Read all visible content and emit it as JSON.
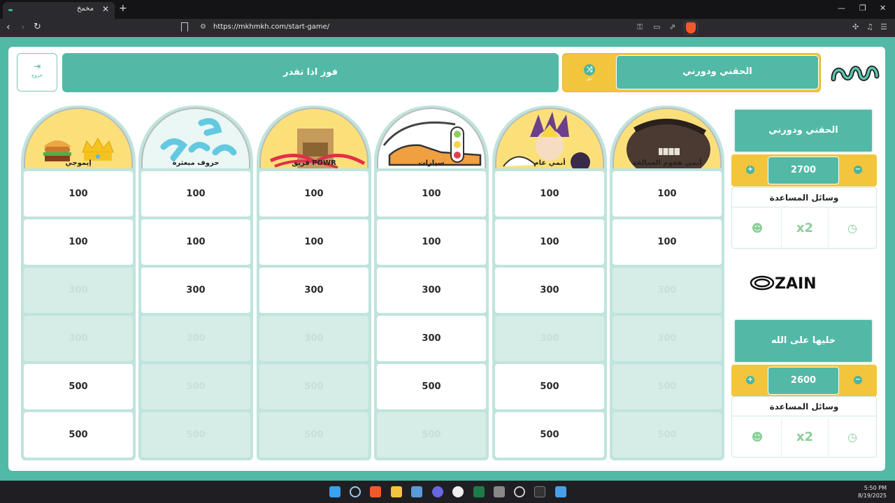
{
  "browser": {
    "tab_title": "مخمخ",
    "tab_close": "✕",
    "new_tab": "+",
    "url": "https://mkhmkh.com/start-game/",
    "win_min": "—",
    "win_max": "❐",
    "win_close": "✕"
  },
  "header": {
    "exit_label": "خروج",
    "game_title": "فوز اذا تقدر",
    "turn_team": "الحقني ودورني",
    "turn_sub": "دور"
  },
  "categories": [
    {
      "title": "إيموجي",
      "cells": [
        {
          "v": "100",
          "on": true
        },
        {
          "v": "100",
          "on": true
        },
        {
          "v": "300",
          "on": false
        },
        {
          "v": "300",
          "on": false
        },
        {
          "v": "500",
          "on": true
        },
        {
          "v": "500",
          "on": true
        }
      ]
    },
    {
      "title": "حروف مبعثرة",
      "cells": [
        {
          "v": "100",
          "on": true
        },
        {
          "v": "100",
          "on": true
        },
        {
          "v": "300",
          "on": true
        },
        {
          "v": "300",
          "on": false
        },
        {
          "v": "500",
          "on": false
        },
        {
          "v": "500",
          "on": false
        }
      ]
    },
    {
      "title": "فريق POWR",
      "cells": [
        {
          "v": "100",
          "on": true
        },
        {
          "v": "100",
          "on": true
        },
        {
          "v": "300",
          "on": true
        },
        {
          "v": "300",
          "on": false
        },
        {
          "v": "500",
          "on": false
        },
        {
          "v": "500",
          "on": false
        }
      ]
    },
    {
      "title": "سيارات",
      "cells": [
        {
          "v": "100",
          "on": true
        },
        {
          "v": "100",
          "on": true
        },
        {
          "v": "300",
          "on": true
        },
        {
          "v": "300",
          "on": true
        },
        {
          "v": "500",
          "on": true
        },
        {
          "v": "500",
          "on": false
        }
      ]
    },
    {
      "title": "أنمي عام",
      "cells": [
        {
          "v": "100",
          "on": true
        },
        {
          "v": "100",
          "on": true
        },
        {
          "v": "300",
          "on": true
        },
        {
          "v": "300",
          "on": false
        },
        {
          "v": "500",
          "on": true
        },
        {
          "v": "500",
          "on": true
        }
      ]
    },
    {
      "title": "أنمي هجوم العمالقة",
      "cells": [
        {
          "v": "100",
          "on": true
        },
        {
          "v": "100",
          "on": true
        },
        {
          "v": "300",
          "on": false
        },
        {
          "v": "300",
          "on": false
        },
        {
          "v": "500",
          "on": false
        },
        {
          "v": "500",
          "on": false
        }
      ]
    }
  ],
  "teams": [
    {
      "name": "الحقني ودورني",
      "score": "2700",
      "help_title": "وسائل المساعدة",
      "help_x2": "x2"
    },
    {
      "name": "خليها على الله",
      "score": "2600",
      "help_title": "وسائل المساعدة",
      "help_x2": "x2"
    }
  ],
  "sponsor": "ZAIN",
  "clock": {
    "time": "5:50 PM",
    "date": "8/19/2025"
  },
  "colors": {
    "teal": "#52b9a6",
    "yellow": "#f2c53d",
    "cell_off": "#d5ece7"
  }
}
